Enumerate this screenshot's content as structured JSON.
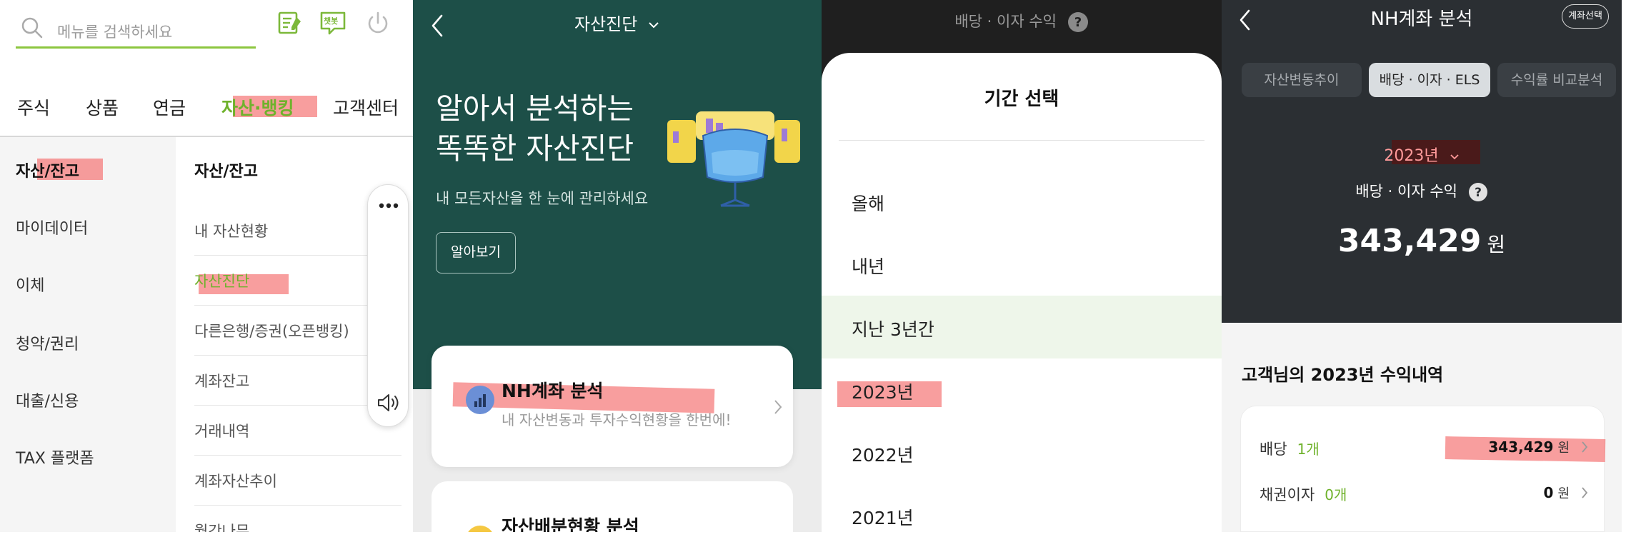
{
  "panel1": {
    "search_placeholder": "메뉴를 검색하세요",
    "top_icons": [
      "edit-icon",
      "chatbot-icon",
      "power-icon"
    ],
    "chatbot_label": "챗봇",
    "categories": [
      "주식",
      "상품",
      "연금",
      "자산·뱅킹",
      "고객센터"
    ],
    "active_category": "자산·뱅킹",
    "left_nav": [
      "자산/잔고",
      "마이데이터",
      "이체",
      "청약/권리",
      "대출/신용",
      "TAX 플랫폼"
    ],
    "section_title": "자산/잔고",
    "right_items": [
      "내 자산현황",
      "자산진단",
      "다른은행/증권(오픈뱅킹)",
      "계좌잔고",
      "거래내역",
      "계좌자산추이",
      "월간나무"
    ],
    "accent_color": "#6fb22c"
  },
  "panel2": {
    "title": "자산진단",
    "headline_line1": "알아서 분석하는",
    "headline_line2": "똑똑한 자산진단",
    "subtitle": "내 모든자산을 한 눈에 관리하세요",
    "button": "알아보기",
    "card1_title": "NH계좌 분석",
    "card1_desc": "내 자산변동과 투자수익현황을 한번에!",
    "card2_title": "자산배분현황 분석",
    "bg_color": "#1d4f48"
  },
  "panel3": {
    "background_title": "배당 · 이자 수익",
    "sheet_title": "기간 선택",
    "options": [
      "올해",
      "내년",
      "지난 3년간",
      "2023년",
      "2022년",
      "2021년"
    ],
    "selected_option": "지난 3년간"
  },
  "panel4": {
    "title": "NH계좌 분석",
    "account_button": "계좌선택",
    "tabs": [
      "자산변동추이",
      "배당 · 이자 · ELS",
      "수익률 비교분석"
    ],
    "active_tab": "배당 · 이자 · ELS",
    "year": "2023년",
    "income_label": "배당 · 이자 수익",
    "total_amount": "343,429",
    "unit": "원",
    "section_title": "고객님의 2023년 수익내역",
    "rows": [
      {
        "label": "배당",
        "count": "1개",
        "value": "343,429",
        "unit": "원"
      },
      {
        "label": "채권이자",
        "count": "0개",
        "value": "0",
        "unit": "원"
      }
    ]
  }
}
